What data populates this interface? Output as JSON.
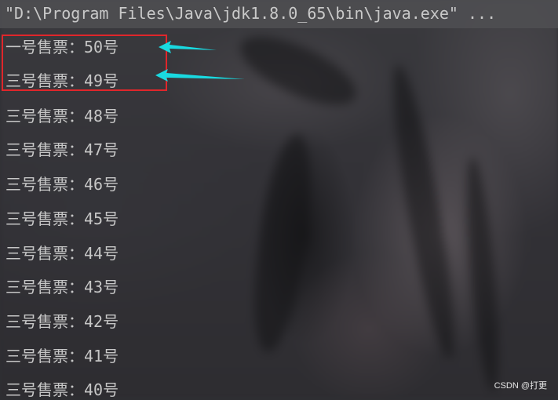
{
  "console": {
    "command": "\"D:\\Program Files\\Java\\jdk1.8.0_65\\bin\\java.exe\" ...",
    "lines": [
      "一号售票：50号",
      "三号售票：49号",
      "三号售票：48号",
      "三号售票：47号",
      "三号售票：46号",
      "三号售票：45号",
      "三号售票：44号",
      "三号售票：43号",
      "三号售票：42号",
      "三号售票：41号",
      "三号售票：40号"
    ]
  },
  "annotation": {
    "highlight_color": "#e0262b",
    "arrow_color": "#19d9e0",
    "arrow_icon": "arrow-left-icon"
  },
  "watermark": {
    "text": "CSDN @打更"
  }
}
